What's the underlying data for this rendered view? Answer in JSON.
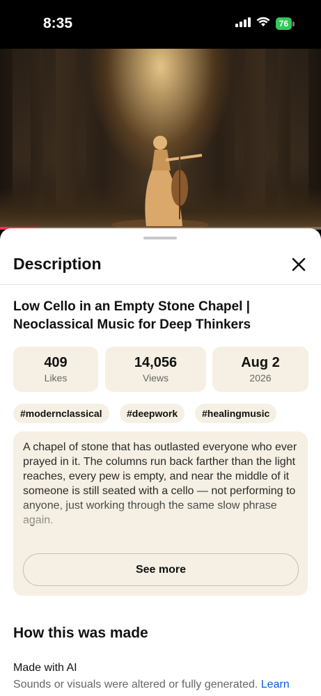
{
  "status_bar": {
    "time": "8:35",
    "battery": "76"
  },
  "video": {
    "progress": 0.12
  },
  "sheet": {
    "title": "Description",
    "video_title": "Low Cello in an Empty Stone Chapel | Neoclassical Music for Deep Thinkers",
    "stats": [
      {
        "value": "409",
        "label": "Likes"
      },
      {
        "value": "14,056",
        "label": "Views"
      },
      {
        "value": "Aug 2",
        "label": "2026"
      }
    ],
    "tags": [
      "#modernclassical",
      "#deepwork",
      "#healingmusic"
    ],
    "description": "A chapel of stone that has outlasted everyone who ever prayed in it. The columns run back farther than the light reaches, every pew is empty, and near the middle of it someone is still seated with a cello — not performing to anyone, just working through the same slow phrase again.",
    "see_more": "See more",
    "how_made_title": "How this was made",
    "ai_title": "Made with AI",
    "ai_desc": "Sounds or visuals were altered or fully generated.",
    "learn_link": "Learn"
  },
  "colors": {
    "accent_link": "#065fd4",
    "card_bg": "#f5f0e3",
    "progress": "#ff2d55",
    "battery": "#34c759"
  }
}
